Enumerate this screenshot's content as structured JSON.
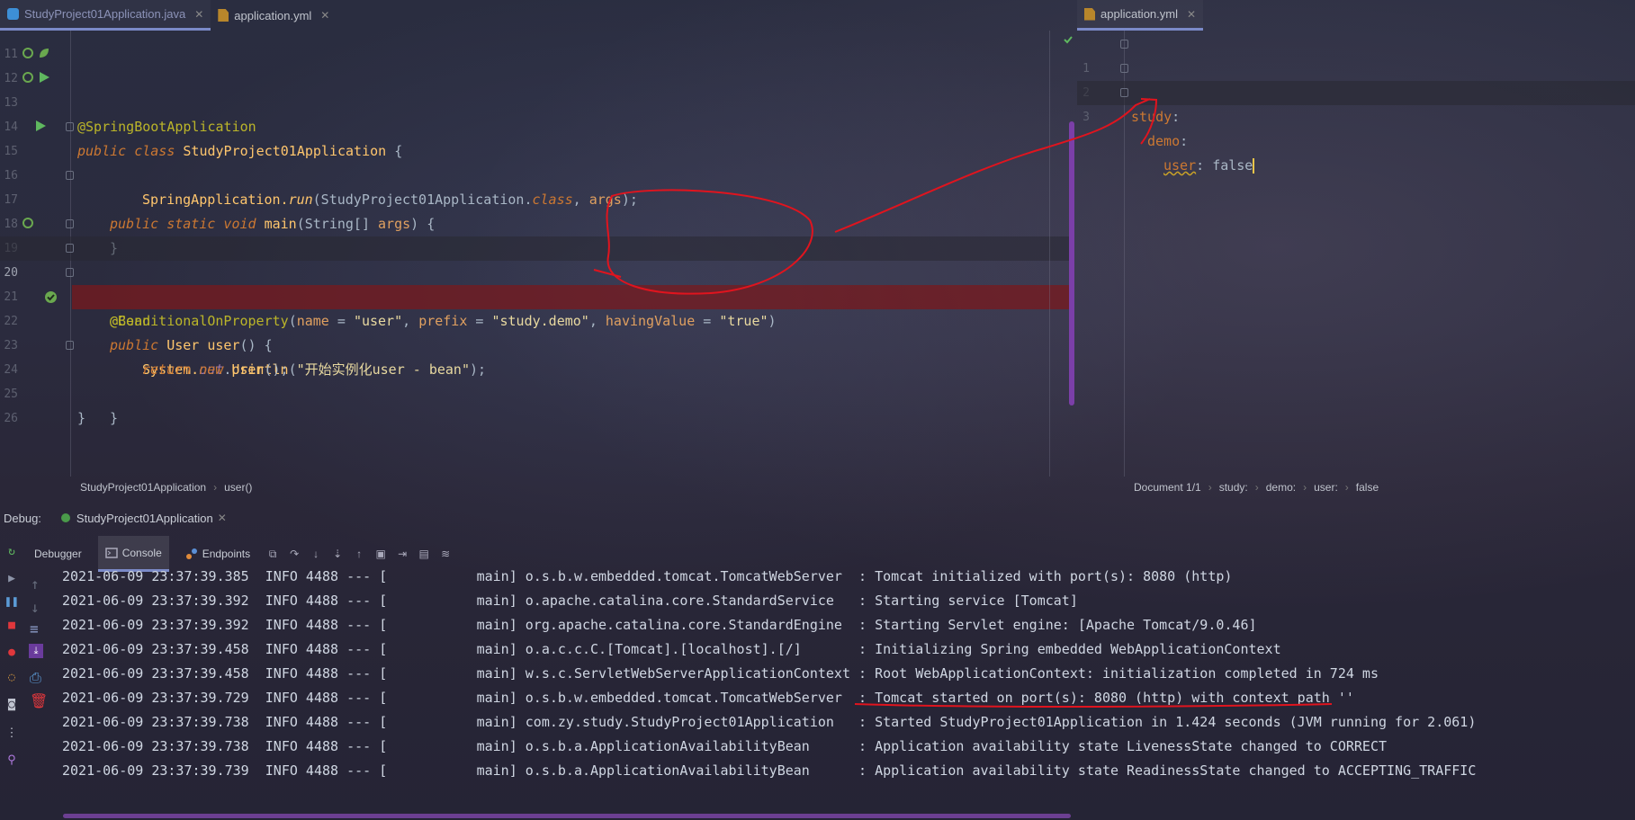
{
  "tabs_left": [
    {
      "label": "StudyProject01Application.java",
      "icon": "java-class-icon",
      "active": true
    },
    {
      "label": "application.yml",
      "icon": "yaml-file-icon",
      "active": false
    }
  ],
  "tabs_right": [
    {
      "label": "application.yml",
      "icon": "yaml-file-icon",
      "active": true
    }
  ],
  "editor": {
    "line_numbers": [
      "11",
      "12",
      "13",
      "14",
      "15",
      "16",
      "17",
      "18",
      "19",
      "20",
      "21",
      "22",
      "23",
      "24",
      "25",
      "26"
    ]
  },
  "code": {
    "l12_ann": "@SpringBootApplication",
    "l13_kw": "public class ",
    "l13_name": "StudyProject01Application",
    "l13_rest": " {",
    "l15_kw": "public static void ",
    "l15_main": "main",
    "l15_p1": "(String[] ",
    "l15_args": "args",
    "l15_p2": ") {",
    "l16_cls": "SpringApplication.",
    "l16_run": "run",
    "l16_p1": "(StudyProject01Application.",
    "l16_class": "class",
    "l16_p2": ", ",
    "l16_args": "args",
    "l16_p3": ");",
    "l17": "}",
    "l19_ann": "@Bean",
    "l20_ann": "@ConditionalOnProperty",
    "l20_p1": "(",
    "l20_name": "name",
    "l20_eq1": " = ",
    "l20_s1": "\"user\"",
    "l20_c1": ", ",
    "l20_prefix": "prefix",
    "l20_eq2": " = ",
    "l20_s2": "\"study.demo\"",
    "l20_c2": ", ",
    "l20_hv": "havingValue",
    "l20_eq3": " = ",
    "l20_s3": "\"true\"",
    "l20_p2": ")",
    "l21_kw": "public ",
    "l21_ty": "User ",
    "l21_m": "user",
    "l21_rest": "() {",
    "l22_sys": "System.",
    "l22_out": "out",
    "l22_dot": ".",
    "l22_pl": "println",
    "l22_p1": "(",
    "l22_str": "\"开始实例化user - bean\"",
    "l22_p2": ");",
    "l23_ret": "return ",
    "l23_new": "new ",
    "l23_ty": "User",
    "l23_rest": "();",
    "l24": "}",
    "l25": "}"
  },
  "yml": {
    "line_numbers": [
      "1",
      "2",
      "3"
    ],
    "l1_key": "study",
    "l1_colon": ":",
    "l2_key": "demo",
    "l2_colon": ":",
    "l3_key": "user",
    "l3_colon": ": ",
    "l3_val": "false"
  },
  "breadcrumbs_left": [
    "StudyProject01Application",
    "user()"
  ],
  "breadcrumbs_right": [
    "Document 1/1",
    "study:",
    "demo:",
    "user:",
    "false"
  ],
  "debug": {
    "label": "Debug:",
    "session": "StudyProject01Application",
    "tabs": [
      "Debugger",
      "Console",
      "Endpoints"
    ]
  },
  "console_lines": [
    "2021-06-09 23:37:39.385  INFO 4488 --- [           main] o.s.b.w.embedded.tomcat.TomcatWebServer  : Tomcat initialized with port(s): 8080 (http)",
    "2021-06-09 23:37:39.392  INFO 4488 --- [           main] o.apache.catalina.core.StandardService   : Starting service [Tomcat]",
    "2021-06-09 23:37:39.392  INFO 4488 --- [           main] org.apache.catalina.core.StandardEngine  : Starting Servlet engine: [Apache Tomcat/9.0.46]",
    "2021-06-09 23:37:39.458  INFO 4488 --- [           main] o.a.c.c.C.[Tomcat].[localhost].[/]       : Initializing Spring embedded WebApplicationContext",
    "2021-06-09 23:37:39.458  INFO 4488 --- [           main] w.s.c.ServletWebServerApplicationContext : Root WebApplicationContext: initialization completed in 724 ms",
    "2021-06-09 23:37:39.729  INFO 4488 --- [           main] o.s.b.w.embedded.tomcat.TomcatWebServer  : Tomcat started on port(s): 8080 (http) with context path ''",
    "2021-06-09 23:37:39.738  INFO 4488 --- [           main] com.zy.study.StudyProject01Application   : Started StudyProject01Application in 1.424 seconds (JVM running for 2.061)",
    "2021-06-09 23:37:39.738  INFO 4488 --- [           main] o.s.b.a.ApplicationAvailabilityBean      : Application availability state LivenessState changed to CORRECT",
    "2021-06-09 23:37:39.739  INFO 4488 --- [           main] o.s.b.a.ApplicationAvailabilityBean      : Application availability state ReadinessState changed to ACCEPTING_TRAFFIC"
  ],
  "colors": {
    "annotation_ink": "#e0141e",
    "breakpoint_line": "#781e24",
    "accent": "#7b8ac8"
  }
}
